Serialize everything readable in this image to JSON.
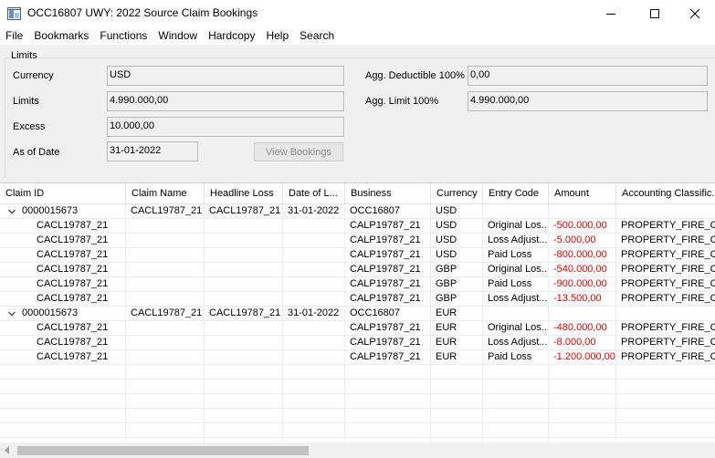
{
  "window": {
    "title": "OCC16807 UWY: 2022 Source Claim Bookings",
    "icons": {
      "app": "grid-app-icon",
      "minimize": "minimize-icon",
      "maximize": "maximize-icon",
      "close": "close-icon"
    }
  },
  "menu": [
    "File",
    "Bookmarks",
    "Functions",
    "Window",
    "Hardcopy",
    "Help",
    "Search"
  ],
  "limits": {
    "group_label": "Limits",
    "currency_label": "Currency",
    "currency_value": "USD",
    "limits_label": "Limits",
    "limits_value": "4.990.000,00",
    "excess_label": "Excess",
    "excess_value": "10.000,00",
    "as_of_label": "As of Date",
    "as_of_value": "31-01-2022",
    "view_bookings_label": "View Bookings",
    "agg_deductible_label": "Agg. Deductible 100%",
    "agg_deductible_value": "0,00",
    "agg_limit_label": "Agg. Limit 100%",
    "agg_limit_value": "4.990.000,00"
  },
  "grid": {
    "columns": [
      "Claim ID",
      "Claim Name",
      "Headline Loss",
      "Date of L...",
      "Business",
      "Currency",
      "Entry Code",
      "Amount",
      "Accounting Classific..."
    ],
    "rows": [
      {
        "group": true,
        "claim_id": "0000015673",
        "claim_name": "CACL19787_21",
        "headline_loss": "CACL19787_21",
        "date": "31-01-2022",
        "business": "OCC16807",
        "currency": "USD",
        "entry_code": "",
        "amount": "",
        "accounting": ""
      },
      {
        "group": false,
        "claim_id": "CACL19787_21",
        "claim_name": "",
        "headline_loss": "",
        "date": "",
        "business": "CALP19787_21",
        "currency": "USD",
        "entry_code": "Original Los...",
        "amount": "-500.000,00",
        "accounting": "PROPERTY_FIRE_C"
      },
      {
        "group": false,
        "claim_id": "CACL19787_21",
        "claim_name": "",
        "headline_loss": "",
        "date": "",
        "business": "CALP19787_21",
        "currency": "USD",
        "entry_code": "Loss Adjust...",
        "amount": "-5.000,00",
        "accounting": "PROPERTY_FIRE_C"
      },
      {
        "group": false,
        "claim_id": "CACL19787_21",
        "claim_name": "",
        "headline_loss": "",
        "date": "",
        "business": "CALP19787_21",
        "currency": "USD",
        "entry_code": "Paid Loss",
        "amount": "-800.000,00",
        "accounting": "PROPERTY_FIRE_C"
      },
      {
        "group": false,
        "claim_id": "CACL19787_21",
        "claim_name": "",
        "headline_loss": "",
        "date": "",
        "business": "CALP19787_21",
        "currency": "GBP",
        "entry_code": "Original Los...",
        "amount": "-540.000,00",
        "accounting": "PROPERTY_FIRE_C"
      },
      {
        "group": false,
        "claim_id": "CACL19787_21",
        "claim_name": "",
        "headline_loss": "",
        "date": "",
        "business": "CALP19787_21",
        "currency": "GBP",
        "entry_code": "Paid Loss",
        "amount": "-900.000,00",
        "accounting": "PROPERTY_FIRE_C"
      },
      {
        "group": false,
        "claim_id": "CACL19787_21",
        "claim_name": "",
        "headline_loss": "",
        "date": "",
        "business": "CALP19787_21",
        "currency": "GBP",
        "entry_code": "Loss Adjust...",
        "amount": "-13.500,00",
        "accounting": "PROPERTY_FIRE_C"
      },
      {
        "group": true,
        "claim_id": "0000015673",
        "claim_name": "CACL19787_21",
        "headline_loss": "CACL19787_21",
        "date": "31-01-2022",
        "business": "OCC16807",
        "currency": "EUR",
        "entry_code": "",
        "amount": "",
        "accounting": ""
      },
      {
        "group": false,
        "claim_id": "CACL19787_21",
        "claim_name": "",
        "headline_loss": "",
        "date": "",
        "business": "CALP19787_21",
        "currency": "EUR",
        "entry_code": "Original Los...",
        "amount": "-480.000,00",
        "accounting": "PROPERTY_FIRE_C"
      },
      {
        "group": false,
        "claim_id": "CACL19787_21",
        "claim_name": "",
        "headline_loss": "",
        "date": "",
        "business": "CALP19787_21",
        "currency": "EUR",
        "entry_code": "Loss Adjust...",
        "amount": "-8.000,00",
        "accounting": "PROPERTY_FIRE_C"
      },
      {
        "group": false,
        "claim_id": "CACL19787_21",
        "claim_name": "",
        "headline_loss": "",
        "date": "",
        "business": "CALP19787_21",
        "currency": "EUR",
        "entry_code": "Paid Loss",
        "amount": "-1.200.000,00",
        "accounting": "PROPERTY_FIRE_C"
      }
    ],
    "empty_rows": 5,
    "colors": {
      "negative_amount": "#e00000"
    }
  }
}
